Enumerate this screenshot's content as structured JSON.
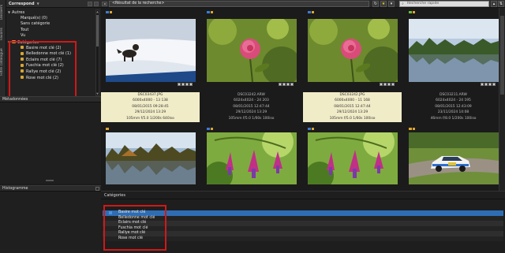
{
  "vertical_tabs": [
    "Dossiers",
    "Favoris",
    "Filtre catalogue"
  ],
  "left_panel": {
    "header": "Correspond",
    "tree": [
      {
        "label": "Autres",
        "level": 0,
        "twisty": "▼"
      },
      {
        "label": "Marqué(s) (0)",
        "level": 1
      },
      {
        "label": "Sans catégorie",
        "level": 1
      },
      {
        "label": "Tout",
        "level": 1
      },
      {
        "label": "Vu",
        "level": 1
      },
      {
        "label": "Catégories",
        "level": 0,
        "twisty": "▼",
        "folder": true
      },
      {
        "label": "Basire mot clé (2)",
        "level": 1,
        "key": true
      },
      {
        "label": "Belledonne mot clé (1)",
        "level": 1,
        "key": true
      },
      {
        "label": "Eclairs mot clé (7)",
        "level": 1,
        "key": true
      },
      {
        "label": "Fuschia mot clé (2)",
        "level": 1,
        "key": true
      },
      {
        "label": "Rallye mot clé (2)",
        "level": 1,
        "key": true
      },
      {
        "label": "Rose mot clé (2)",
        "level": 1,
        "key": true
      }
    ]
  },
  "sections": {
    "metadata": "Métadonnées",
    "histogram": "Histogramme"
  },
  "toolbar": {
    "path": "<Résultat de la recherche>",
    "search_placeholder": "Recherche rapide",
    "star": "★",
    "back": "◂",
    "refresh": "↻",
    "filter": "▾",
    "up": "▴",
    "sort": "⇅"
  },
  "thumbnails_row1": [
    {
      "stars": [
        "#3b7cd9",
        "#e0a52c"
      ],
      "selected": true,
      "lines": [
        "DSC03437.JPG",
        "6000x4000 - 13 138",
        "08/01/2015 09:28:45",
        "29/12/2024 13:29",
        "105mm f/5.0 1/200s 640iso"
      ]
    },
    {
      "stars": [
        "#3b7cd9",
        "#e0a52c"
      ],
      "selected": false,
      "lines": [
        "DSC03242.ARW",
        "6024x4024 - 24 203",
        "08/01/2015 12:47:44",
        "29/12/2024 13:29",
        "105mm f/5.0 1/60s 100iso"
      ]
    },
    {
      "stars": [
        "#3b7cd9",
        "#e0a52c"
      ],
      "selected": true,
      "lines": [
        "DSC03242.JPG",
        "6000x4000 - 11 168",
        "08/01/2015 12:47:44",
        "29/12/2024 13:29",
        "105mm f/5.0 1/60s 100iso"
      ]
    },
    {
      "stars": [
        "#6ac03a",
        "#e0a52c"
      ],
      "selected": false,
      "lines": [
        "DSC03211.ARW",
        "6024x4024 - 24 195",
        "08/01/2015 12:43:09",
        "23/11/2024 14:08",
        "46mm f/8.0 1/200s 100iso"
      ]
    }
  ],
  "thumbnails_row2": [
    {
      "stars": [
        "#e0a52c"
      ]
    },
    {
      "stars": [
        "#3b7cd9",
        "#e0a52c"
      ]
    },
    {
      "stars": [
        "#3b7cd9",
        "#e0a52c"
      ]
    },
    {
      "stars": [
        "#e0a52c",
        "#e0a52c"
      ]
    }
  ],
  "categories_panel": {
    "title": "Catégories",
    "items": [
      {
        "label": "Basire mot clé",
        "selected": true
      },
      {
        "label": "Belledonne mot clé"
      },
      {
        "label": "Eclairs mot clé"
      },
      {
        "label": "Fuschia mot clé"
      },
      {
        "label": "Rallye mot clé"
      },
      {
        "label": "Rose mot clé"
      }
    ]
  }
}
